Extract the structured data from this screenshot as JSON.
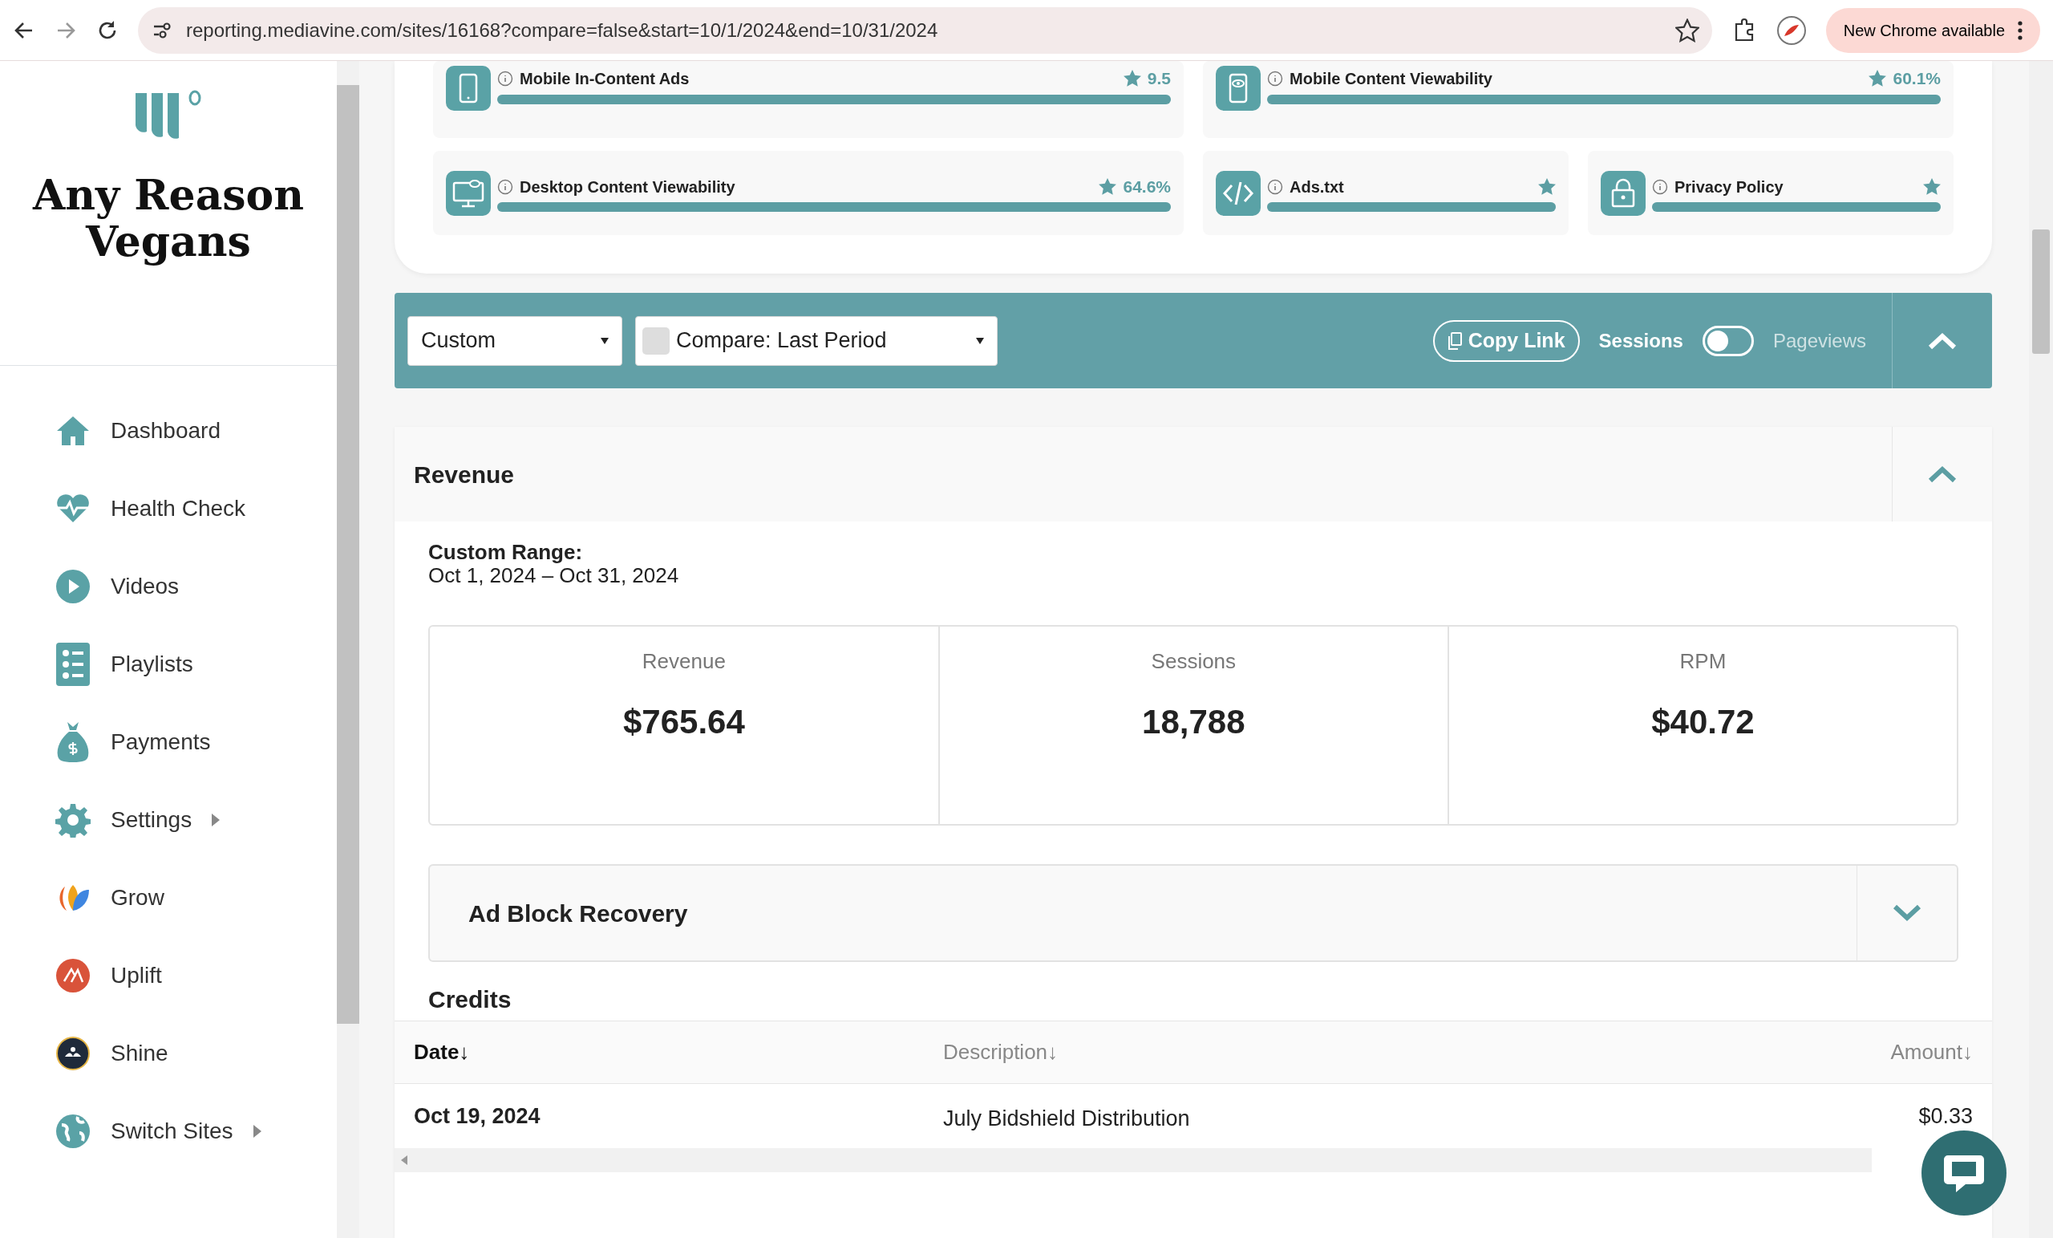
{
  "browser": {
    "url": "reporting.mediavine.com/sites/16168?compare=false&start=10/1/2024&end=10/31/2024",
    "update_label": "New Chrome available"
  },
  "sidebar": {
    "site_name": "Any Reason Vegans",
    "items": [
      {
        "label": "Dashboard",
        "has_submenu": false
      },
      {
        "label": "Health Check",
        "has_submenu": false
      },
      {
        "label": "Videos",
        "has_submenu": false
      },
      {
        "label": "Playlists",
        "has_submenu": false
      },
      {
        "label": "Payments",
        "has_submenu": false
      },
      {
        "label": "Settings",
        "has_submenu": true
      },
      {
        "label": "Grow",
        "has_submenu": false
      },
      {
        "label": "Uplift",
        "has_submenu": false
      },
      {
        "label": "Shine",
        "has_submenu": false
      },
      {
        "label": "Switch Sites",
        "has_submenu": true
      }
    ]
  },
  "health_rows": [
    [
      {
        "label": "Mobile In-Content Ads",
        "score": "9.5",
        "level": 1
      },
      {
        "label": "Mobile Content Viewability",
        "score": "60.1%",
        "level": 1
      }
    ],
    [
      {
        "label": "Desktop Content Viewability",
        "score": "64.6%",
        "level": 1
      },
      {
        "label": "Ads.txt",
        "level": 1
      },
      {
        "label": "Privacy Policy",
        "level": 1
      }
    ]
  ],
  "toolbar": {
    "range_select": "Custom",
    "compare": {
      "label": "Compare: Last Period",
      "checked": false
    },
    "copy_link": "Copy Link",
    "toggle": {
      "left_label": "Sessions",
      "right_label": "Pageviews",
      "on": false
    }
  },
  "revenue": {
    "title": "Revenue",
    "range_label": "Custom Range:",
    "range_dates": "Oct 1, 2024 – Oct 31, 2024",
    "stats": [
      {
        "label": "Revenue",
        "value": "$765.64"
      },
      {
        "label": "Sessions",
        "value": "18,788"
      },
      {
        "label": "RPM",
        "value": "$40.72"
      }
    ],
    "ad_block": {
      "title": "Ad Block Recovery",
      "expanded": false
    },
    "credits_title": "Credits",
    "table": {
      "columns": [
        {
          "label": "Date↓",
          "selected": true
        },
        {
          "label": "Description↓",
          "selected": false
        },
        {
          "label": "Amount↓",
          "selected": false
        }
      ],
      "rows": [
        [
          "Oct 19, 2024",
          "July Bidshield Distribution",
          "$0.33"
        ]
      ]
    }
  }
}
